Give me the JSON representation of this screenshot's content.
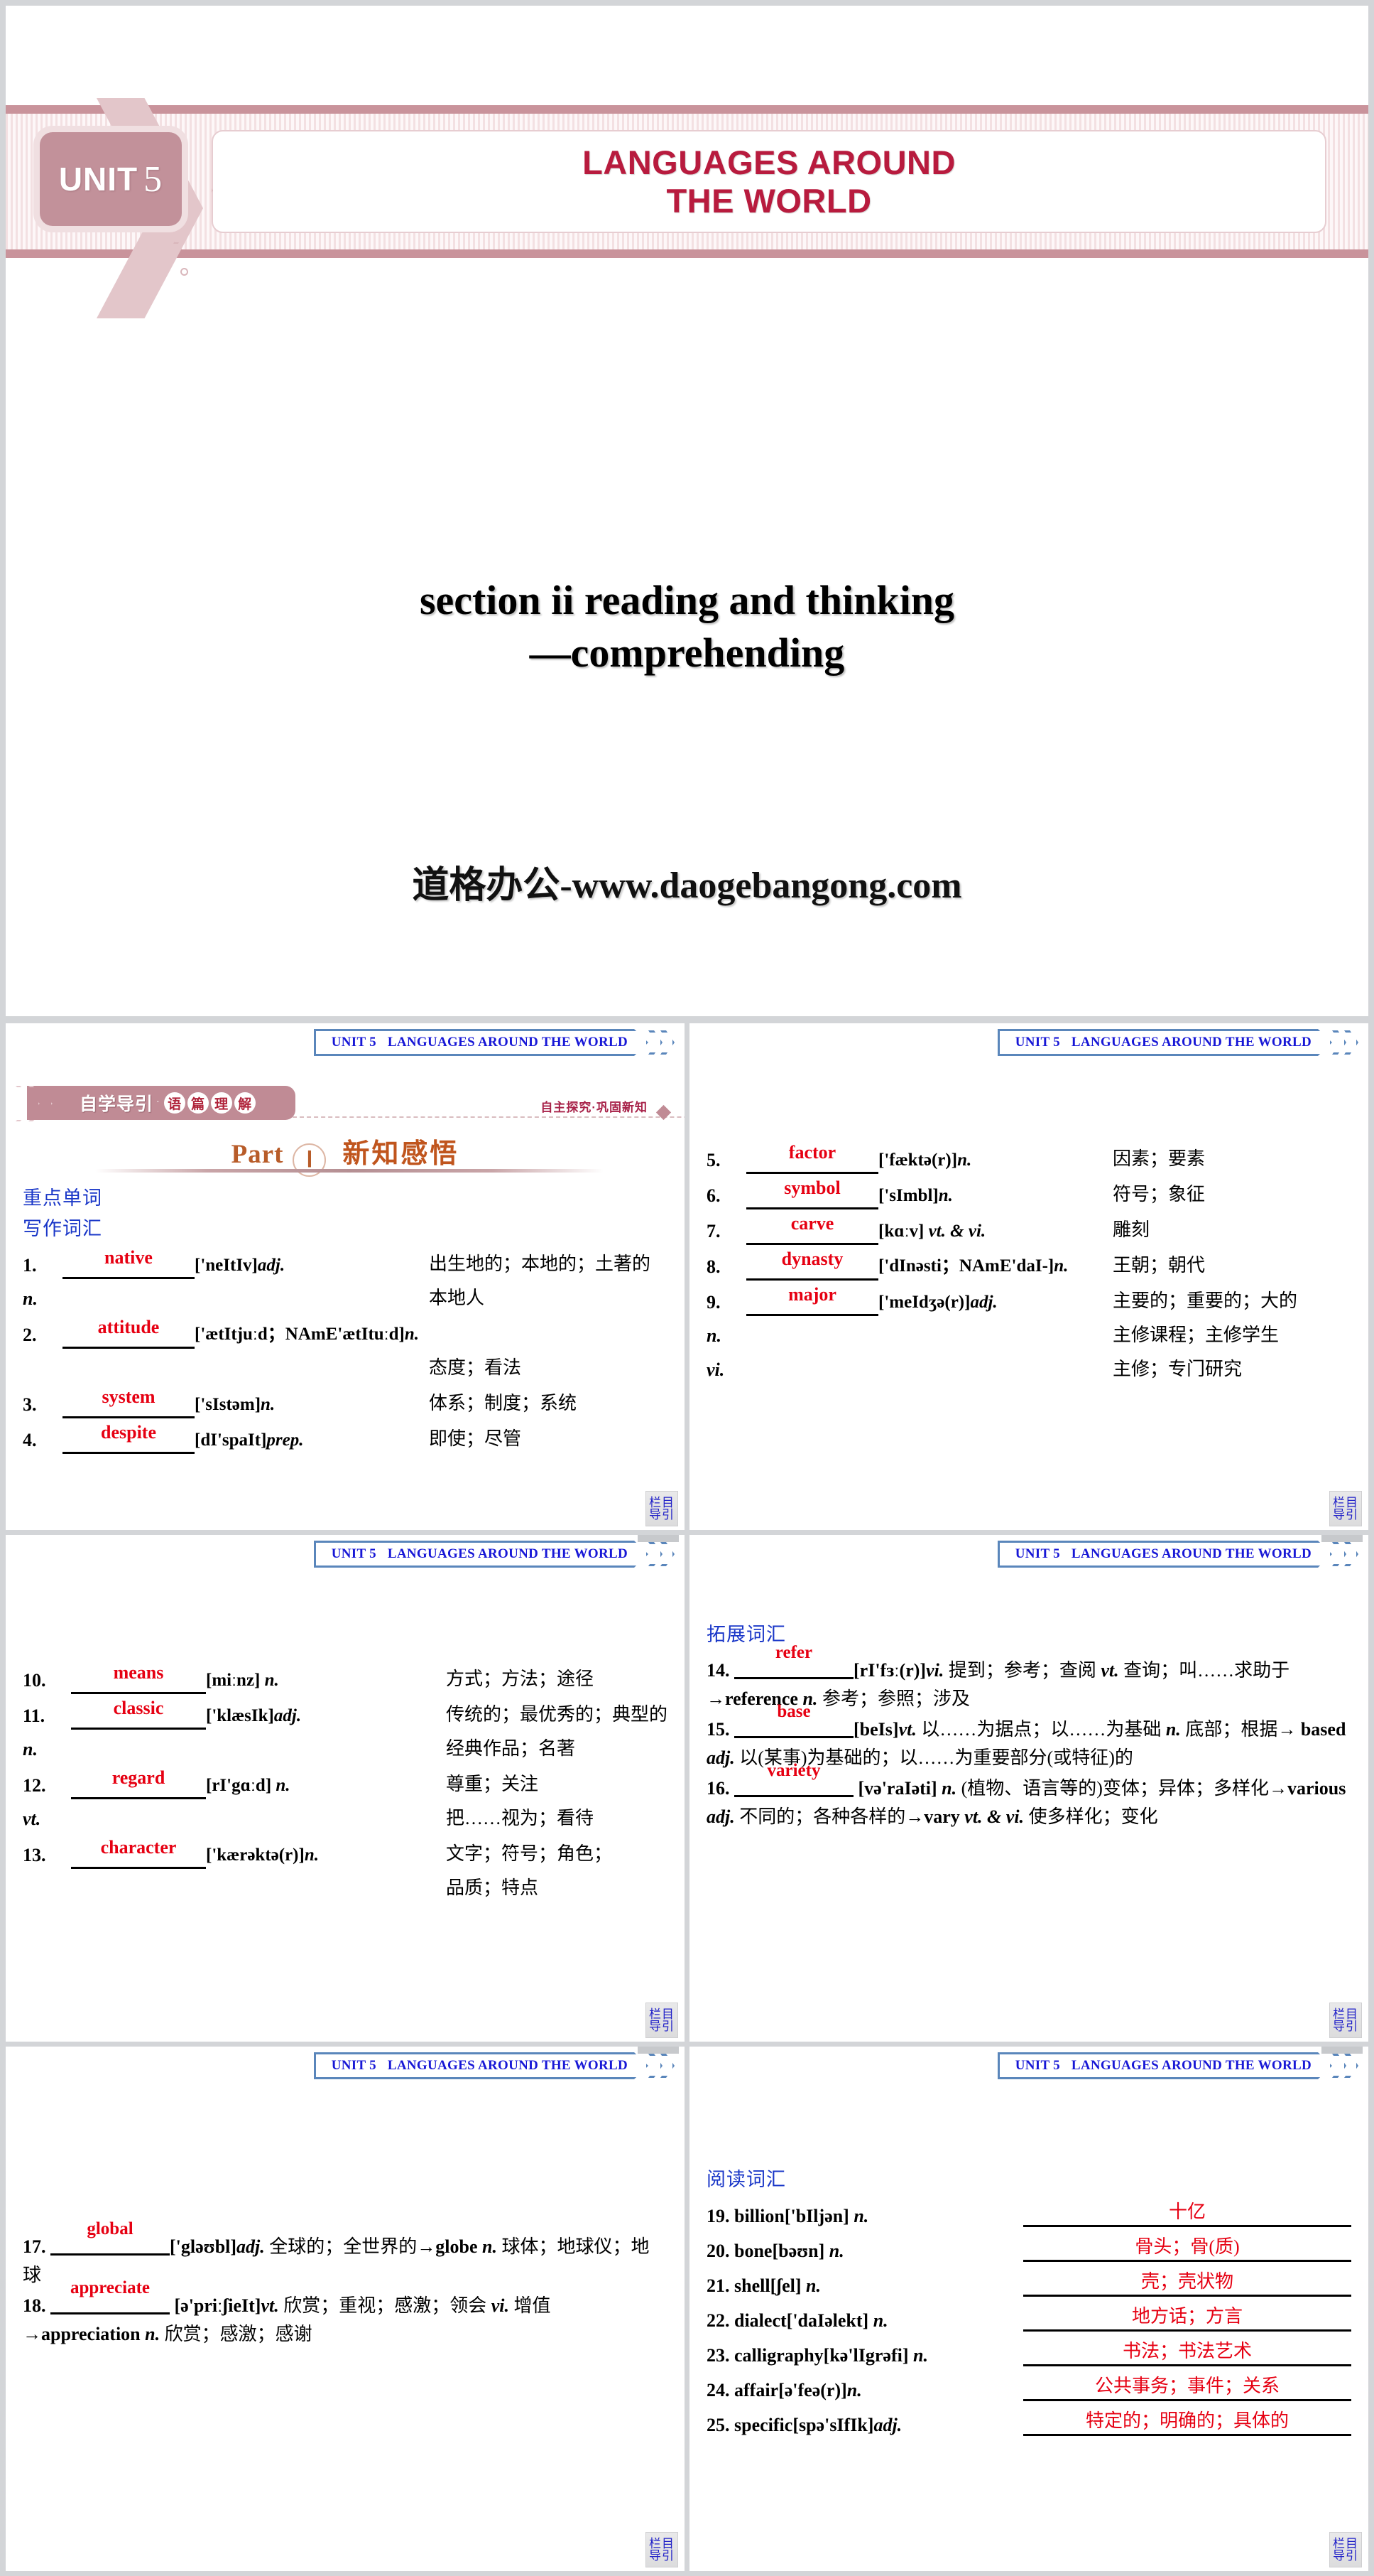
{
  "cover": {
    "unit_label": "UNIT",
    "unit_number": "5",
    "title_line1": "LANGUAGES AROUND",
    "title_line2": "THE WORLD",
    "subtitle_line1": "section ii reading and thinking",
    "subtitle_line2": "—comprehending",
    "watermark": "道格办公-www.daogebangong.com",
    "accent_color": "#b81b3e",
    "banner_color": "#c9939b"
  },
  "panel_header": {
    "unit": "UNIT 5",
    "title": "LANGUAGES AROUND THE WORLD"
  },
  "corner_badge": {
    "line1": "栏目",
    "line2": "导引"
  },
  "slide1": {
    "ribbon_main": "自学导引",
    "ribbon_dot": "·",
    "ribbon_circles": [
      "语",
      "篇",
      "理",
      "解"
    ],
    "sub_label": "自主探究·巩固新知",
    "part_word": "Part",
    "part_number": "Ⅰ",
    "part_cn": "新知感悟",
    "section_label_1": "重点单词",
    "section_label_2": "写作词汇",
    "entries": [
      {
        "num": "1.",
        "answer": "native",
        "phonetic": "['neItIv]",
        "pos": "adj.",
        "meaning": "出生地的；本地的；土著的"
      },
      {
        "cont_pos": "n.",
        "meaning": "本地人"
      },
      {
        "num": "2.",
        "answer": "attitude",
        "phonetic": "['ætItjuːd；NAmE'ætItuːd]",
        "pos": "n.",
        "meaning": ""
      },
      {
        "meaning": "态度；看法"
      },
      {
        "num": "3.",
        "answer": "system",
        "phonetic": "['sIstəm]",
        "pos": "n.",
        "meaning": "体系；制度；系统"
      },
      {
        "num": "4.",
        "answer": "despite",
        "phonetic": "[dI'spaIt]",
        "pos": "prep.",
        "meaning": "即使；尽管"
      }
    ]
  },
  "slide2": {
    "entries": [
      {
        "num": "5.",
        "answer": "factor",
        "phonetic": "['fæktə(r)]",
        "pos": "n.",
        "meaning": "因素；要素"
      },
      {
        "num": "6.",
        "answer": "symbol",
        "phonetic": "['sImbl]",
        "pos": "n.",
        "meaning": "符号；象征"
      },
      {
        "num": "7.",
        "answer": "carve",
        "phonetic": "[kɑːv]",
        "pos": "vt. & vi.",
        "meaning": "雕刻"
      },
      {
        "num": "8.",
        "answer": "dynasty",
        "phonetic": "['dInəsti；NAmE'daI-]",
        "pos": "n.",
        "meaning": "王朝；朝代"
      },
      {
        "num": "9.",
        "answer": "major",
        "phonetic": "['meIdʒə(r)]",
        "pos": "adj.",
        "meaning": "主要的；重要的；大的"
      },
      {
        "cont_pos": "n.",
        "meaning": "主修课程；主修学生"
      },
      {
        "cont_pos": "vi.",
        "meaning": "主修；专门研究"
      }
    ]
  },
  "slide3": {
    "entries": [
      {
        "num": "10.",
        "answer": "means",
        "phonetic": "[miːnz]",
        "pos": "n.",
        "meaning": "方式；方法；途径"
      },
      {
        "num": "11.",
        "answer": "classic",
        "phonetic": "['klæsIk]",
        "pos": "adj.",
        "meaning": "传统的；最优秀的；典型的"
      },
      {
        "cont_pos": "n.",
        "meaning": "经典作品；名著"
      },
      {
        "num": "12.",
        "answer": "regard",
        "phonetic": "[rI'gɑːd]",
        "pos": "n.",
        "meaning": "尊重；关注"
      },
      {
        "cont_pos": "vt.",
        "meaning": "把……视为；看待"
      },
      {
        "num": "13.",
        "answer": "character",
        "phonetic": "['kærəktə(r)]",
        "pos": "n.",
        "meaning": "文字；符号；角色；"
      },
      {
        "meaning": "品质；特点"
      }
    ]
  },
  "slide4": {
    "section_label": "拓展词汇",
    "items": [
      {
        "num": "14.",
        "answer": "refer",
        "text_parts": [
          {
            "t": "[rI'fɜː(r)]",
            "style": "b"
          },
          {
            "t": "vi.",
            "style": "i"
          },
          {
            "t": " 提到；参考；查阅 ",
            "style": "n"
          },
          {
            "t": "vt.",
            "style": "i"
          },
          {
            "t": " 查询；叫……求助于→",
            "style": "n"
          },
          {
            "t": "reference",
            "style": "b"
          },
          {
            "t": " n.",
            "style": "i"
          },
          {
            "t": " 参考；参照；涉及",
            "style": "n"
          }
        ]
      },
      {
        "num": "15.",
        "answer": "base",
        "text_parts": [
          {
            "t": "[beIs]",
            "style": "b"
          },
          {
            "t": "vt.",
            "style": "i"
          },
          {
            "t": " 以……为据点；以……为基础 ",
            "style": "n"
          },
          {
            "t": "n.",
            "style": "i"
          },
          {
            "t": " 底部；根据→ ",
            "style": "n"
          },
          {
            "t": "based",
            "style": "b"
          },
          {
            "t": " adj.",
            "style": "i"
          },
          {
            "t": " 以(某事)为基础的；以……为重要部分(或特征)的",
            "style": "n"
          }
        ]
      },
      {
        "num": "16.",
        "answer": "variety",
        "text_parts": [
          {
            "t": "[və'raIəti]",
            "style": "b"
          },
          {
            "t": " n.",
            "style": "i"
          },
          {
            "t": " (植物、语言等的)变体；异体；多样化→",
            "style": "n"
          },
          {
            "t": "various",
            "style": "b"
          },
          {
            "t": " adj.",
            "style": "i"
          },
          {
            "t": " 不同的；各种各样的→",
            "style": "n"
          },
          {
            "t": "vary",
            "style": "b"
          },
          {
            "t": " vt. & vi.",
            "style": "i"
          },
          {
            "t": " 使多样化；变化",
            "style": "n"
          }
        ]
      }
    ]
  },
  "slide5": {
    "items": [
      {
        "num": "17.",
        "answer": "global",
        "text_parts": [
          {
            "t": "['gləʊbl]",
            "style": "b"
          },
          {
            "t": "adj.",
            "style": "i"
          },
          {
            "t": " 全球的；全世界的→",
            "style": "n"
          },
          {
            "t": "globe",
            "style": "b"
          },
          {
            "t": " n.",
            "style": "i"
          },
          {
            "t": " 球体；地球仪；地球",
            "style": "n"
          }
        ]
      },
      {
        "num": "18.",
        "answer": "appreciate",
        "text_parts": [
          {
            "t": "[ə'priːʃieIt]",
            "style": "b"
          },
          {
            "t": "vt.",
            "style": "i"
          },
          {
            "t": " 欣赏；重视；感激；领会 ",
            "style": "n"
          },
          {
            "t": "vi.",
            "style": "i"
          },
          {
            "t": " 增值→",
            "style": "n"
          },
          {
            "t": "appreciation",
            "style": "b"
          },
          {
            "t": " n.",
            "style": "i"
          },
          {
            "t": " 欣赏；感激；感谢",
            "style": "n"
          }
        ]
      }
    ]
  },
  "slide6": {
    "section_label": "阅读词汇",
    "rows": [
      {
        "num": "19.",
        "word": "billion",
        "phonetic": "['bIljən]",
        "pos": "n.",
        "answer": "十亿"
      },
      {
        "num": "20.",
        "word": "bone",
        "phonetic": "[bəʊn]",
        "pos": "n.",
        "answer": "骨头；骨(质)"
      },
      {
        "num": "21.",
        "word": "shell",
        "phonetic": "[ʃel]",
        "pos": "n.",
        "answer": "壳；壳状物"
      },
      {
        "num": "22.",
        "word": "dialect",
        "phonetic": "['daIəlekt]",
        "pos": "n.",
        "answer": "地方话；方言"
      },
      {
        "num": "23.",
        "word": "calligraphy",
        "phonetic": "[kə'lIgrəfi]",
        "pos": "n.",
        "answer": "书法；书法艺术"
      },
      {
        "num": "24.",
        "word": "affair",
        "phonetic": "[ə'feə(r)]",
        "pos": "n.",
        "answer": "公共事务；事件；关系"
      },
      {
        "num": "25.",
        "word": "specific",
        "phonetic": "[spə'sIfIk]",
        "pos": "adj.",
        "answer": "特定的；明确的；具体的"
      }
    ]
  }
}
